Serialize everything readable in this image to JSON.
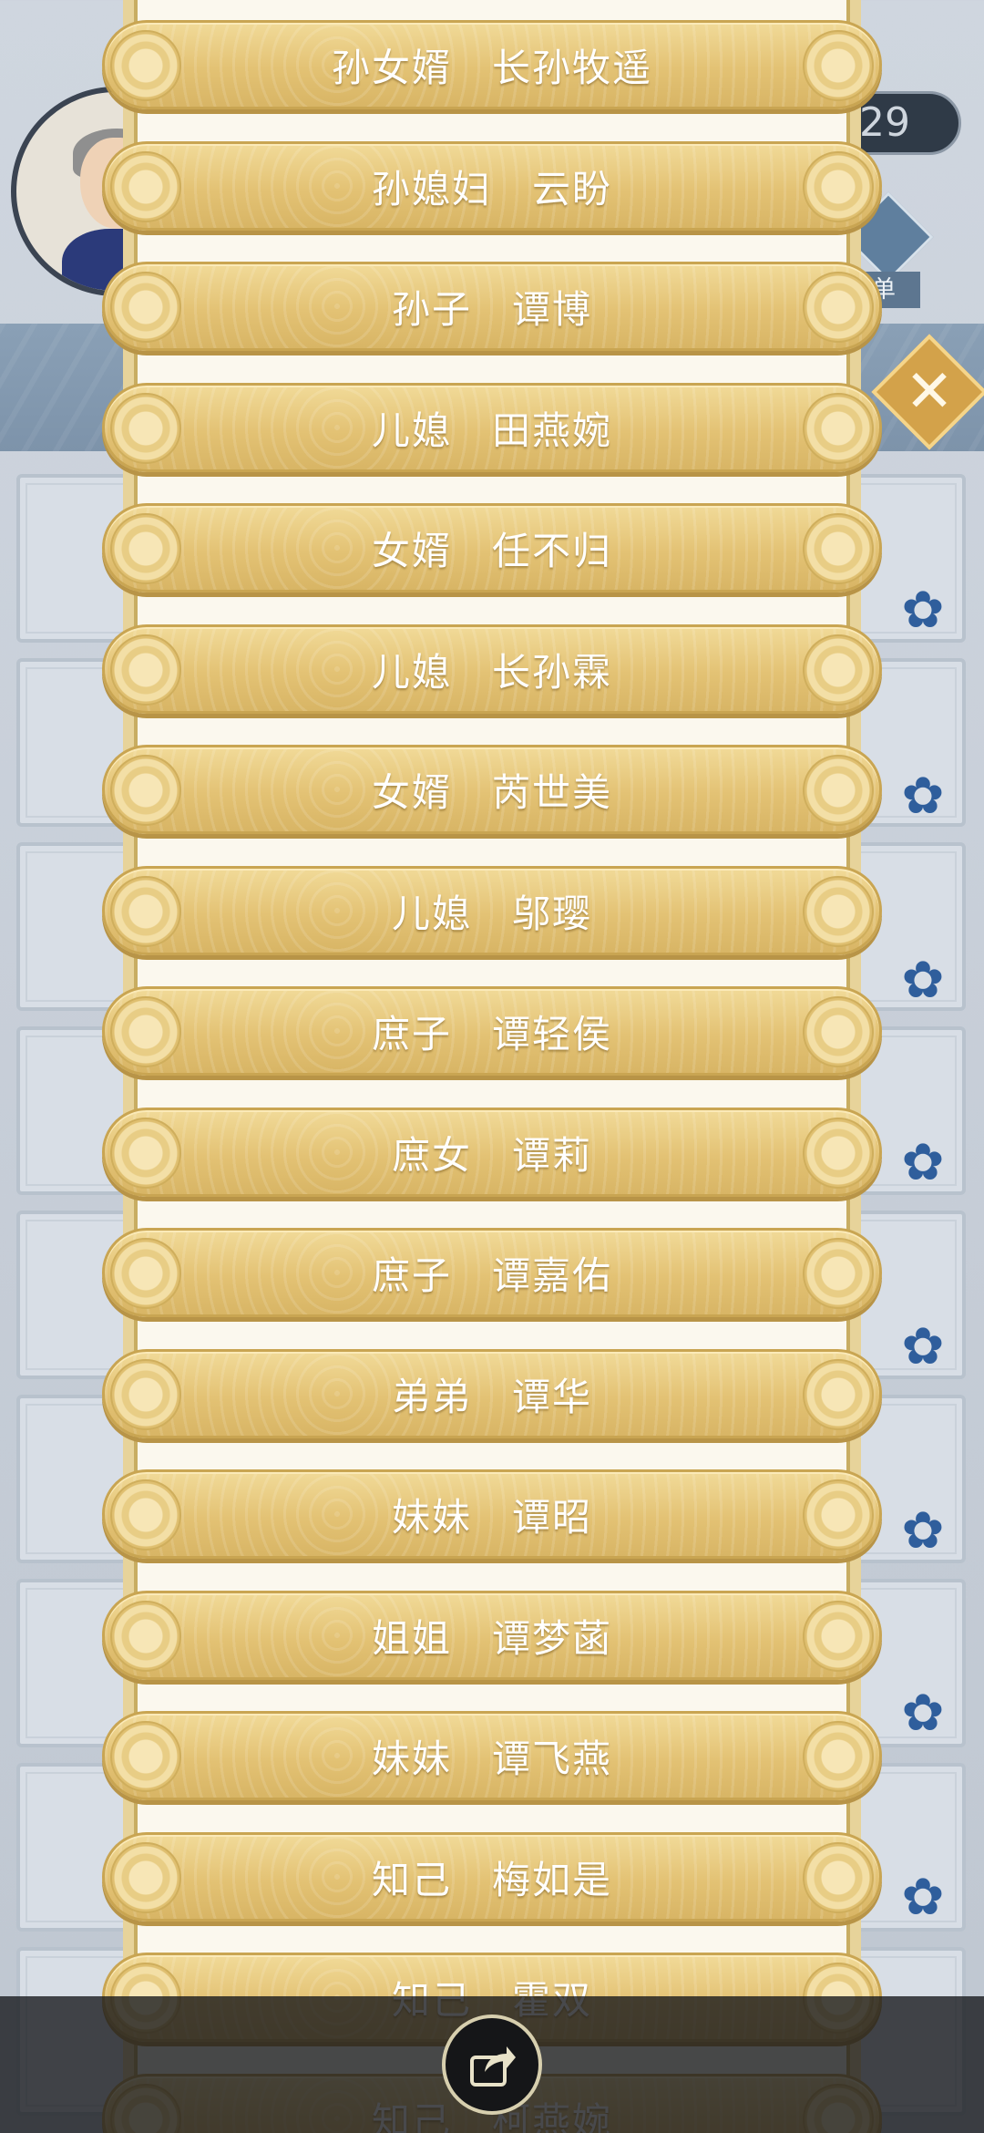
{
  "hud": {
    "counter_text": "29",
    "menu_label": "单",
    "close_symbol": "✕"
  },
  "relatives": [
    {
      "relation": "孙女婿",
      "name": "长孙牧遥"
    },
    {
      "relation": "孙媳妇",
      "name": "云盼"
    },
    {
      "relation": "孙子",
      "name": "谭博"
    },
    {
      "relation": "儿媳",
      "name": "田燕婉"
    },
    {
      "relation": "女婿",
      "name": "任不归"
    },
    {
      "relation": "儿媳",
      "name": "长孙霖"
    },
    {
      "relation": "女婿",
      "name": "芮世美"
    },
    {
      "relation": "儿媳",
      "name": "邬璎"
    },
    {
      "relation": "庶子",
      "name": "谭轻侯"
    },
    {
      "relation": "庶女",
      "name": "谭莉"
    },
    {
      "relation": "庶子",
      "name": "谭嘉佑"
    },
    {
      "relation": "弟弟",
      "name": "谭华"
    },
    {
      "relation": "妹妹",
      "name": "谭昭"
    },
    {
      "relation": "姐姐",
      "name": "谭梦菡"
    },
    {
      "relation": "妹妹",
      "name": "谭飞燕"
    },
    {
      "relation": "知己",
      "name": "梅如是"
    },
    {
      "relation": "知己",
      "name": "霍双"
    },
    {
      "relation": "知己",
      "name": "柯燕婉"
    }
  ],
  "colors": {
    "row_gold": "#e3c274",
    "scroll_paper": "#fbf8ee",
    "accent_blue": "#2f5e9c"
  },
  "icons": {
    "share": "share-icon",
    "close": "close-icon",
    "flower": "plum-blossom-icon"
  }
}
